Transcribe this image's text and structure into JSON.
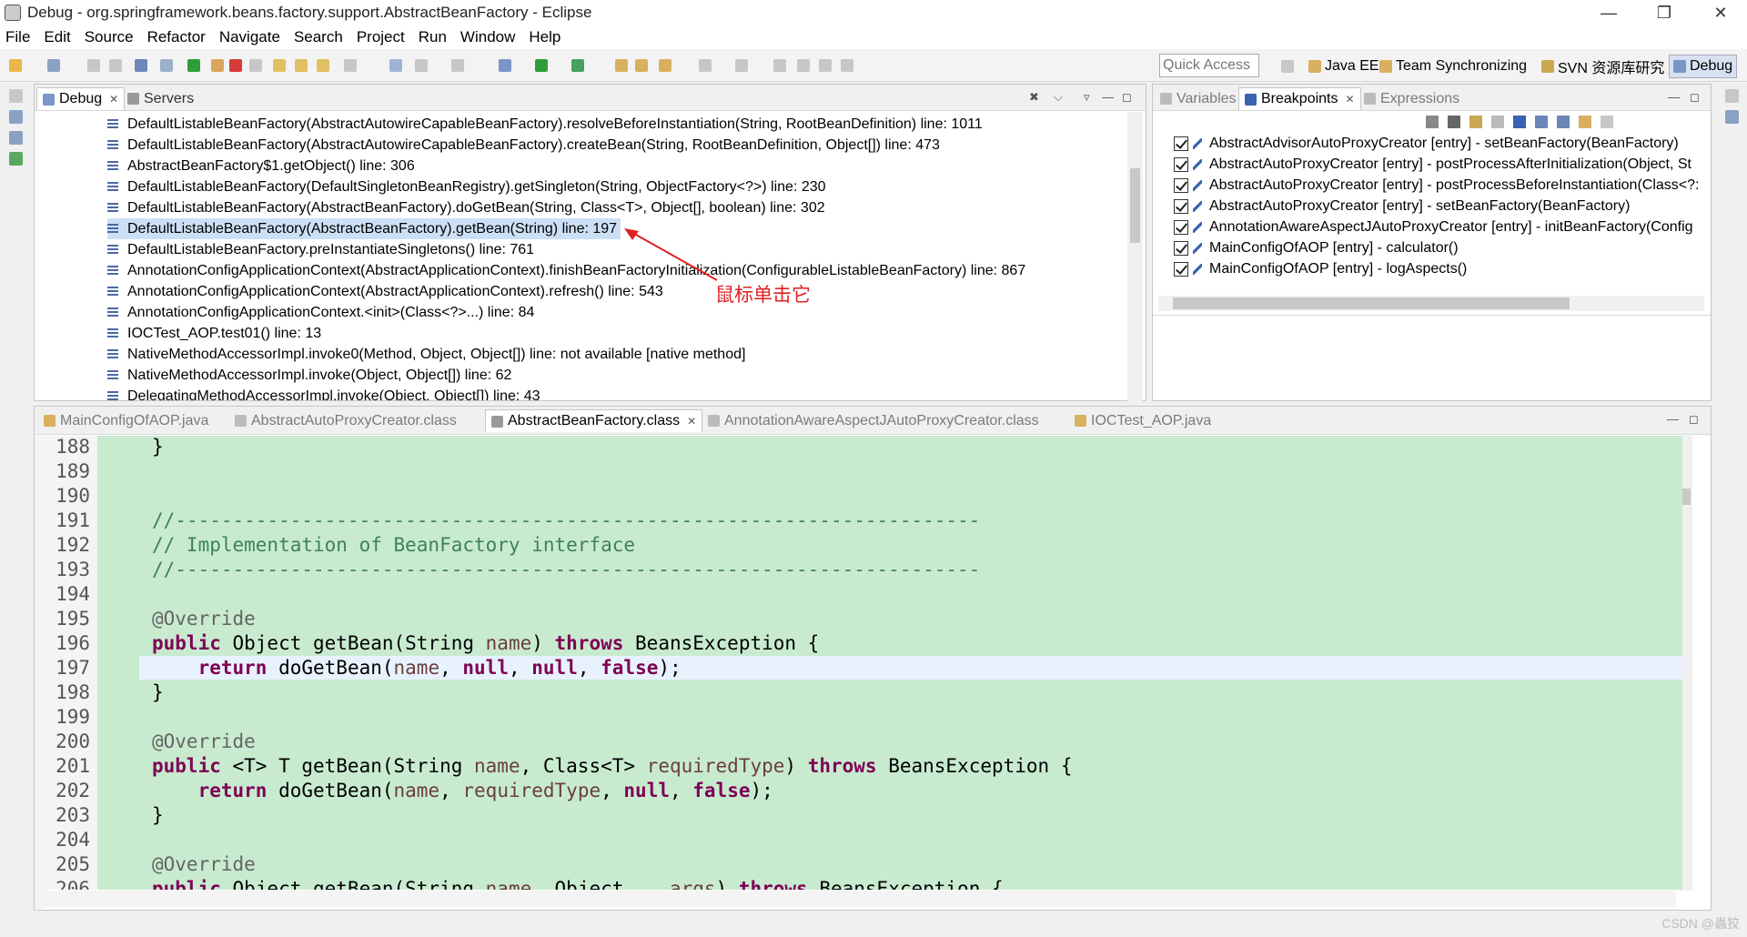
{
  "window": {
    "title": "Debug - org.springframework.beans.factory.support.AbstractBeanFactory - Eclipse"
  },
  "menu": [
    "File",
    "Edit",
    "Source",
    "Refactor",
    "Navigate",
    "Search",
    "Project",
    "Run",
    "Window",
    "Help"
  ],
  "quick_access": {
    "placeholder": "Quick Access"
  },
  "perspectives": [
    "Java EE",
    "Team Synchronizing",
    "SVN 资源库研究",
    "Debug"
  ],
  "debug_view": {
    "tabs": [
      "Debug",
      "Servers"
    ],
    "frames": [
      "DefaultListableBeanFactory(AbstractAutowireCapableBeanFactory).resolveBeforeInstantiation(String, RootBeanDefinition) line: 1011",
      "DefaultListableBeanFactory(AbstractAutowireCapableBeanFactory).createBean(String, RootBeanDefinition, Object[]) line: 473",
      "AbstractBeanFactory$1.getObject() line: 306",
      "DefaultListableBeanFactory(DefaultSingletonBeanRegistry).getSingleton(String, ObjectFactory<?>) line: 230",
      "DefaultListableBeanFactory(AbstractBeanFactory).doGetBean(String, Class<T>, Object[], boolean) line: 302",
      "DefaultListableBeanFactory(AbstractBeanFactory).getBean(String) line: 197",
      "DefaultListableBeanFactory.preInstantiateSingletons() line: 761",
      "AnnotationConfigApplicationContext(AbstractApplicationContext).finishBeanFactoryInitialization(ConfigurableListableBeanFactory) line: 867",
      "AnnotationConfigApplicationContext(AbstractApplicationContext).refresh() line: 543",
      "AnnotationConfigApplicationContext.<init>(Class<?>...) line: 84",
      "IOCTest_AOP.test01() line: 13",
      "NativeMethodAccessorImpl.invoke0(Method, Object, Object[]) line: not available [native method]",
      "NativeMethodAccessorImpl.invoke(Object, Object[]) line: 62",
      "DelegatingMethodAccessorImpl.invoke(Object, Object[]) line: 43"
    ],
    "annotation": "鼠标单击它"
  },
  "breakpoints_view": {
    "tabs": [
      "Variables",
      "Breakpoints",
      "Expressions"
    ],
    "items": [
      "AbstractAdvisorAutoProxyCreator [entry] - setBeanFactory(BeanFactory)",
      "AbstractAutoProxyCreator [entry] - postProcessAfterInitialization(Object, St",
      "AbstractAutoProxyCreator [entry] - postProcessBeforeInstantiation(Class<?:",
      "AbstractAutoProxyCreator [entry] - setBeanFactory(BeanFactory)",
      "AnnotationAwareAspectJAutoProxyCreator [entry] - initBeanFactory(Config",
      "MainConfigOfAOP [entry] - calculator()",
      "MainConfigOfAOP [entry] - logAspects()"
    ]
  },
  "editor": {
    "tabs": [
      "MainConfigOfAOP.java",
      "AbstractAutoProxyCreator.class",
      "AbstractBeanFactory.class",
      "AnnotationAwareAspectJAutoProxyCreator.class",
      "IOCTest_AOP.java"
    ],
    "line_numbers": [
      "188",
      "189",
      "190",
      "191",
      "192",
      "193",
      "194",
      "195",
      "196",
      "197",
      "198",
      "199",
      "200",
      "201",
      "202",
      "203",
      "204",
      "205",
      "206"
    ]
  },
  "watermark": "CSDN @蟲狡"
}
